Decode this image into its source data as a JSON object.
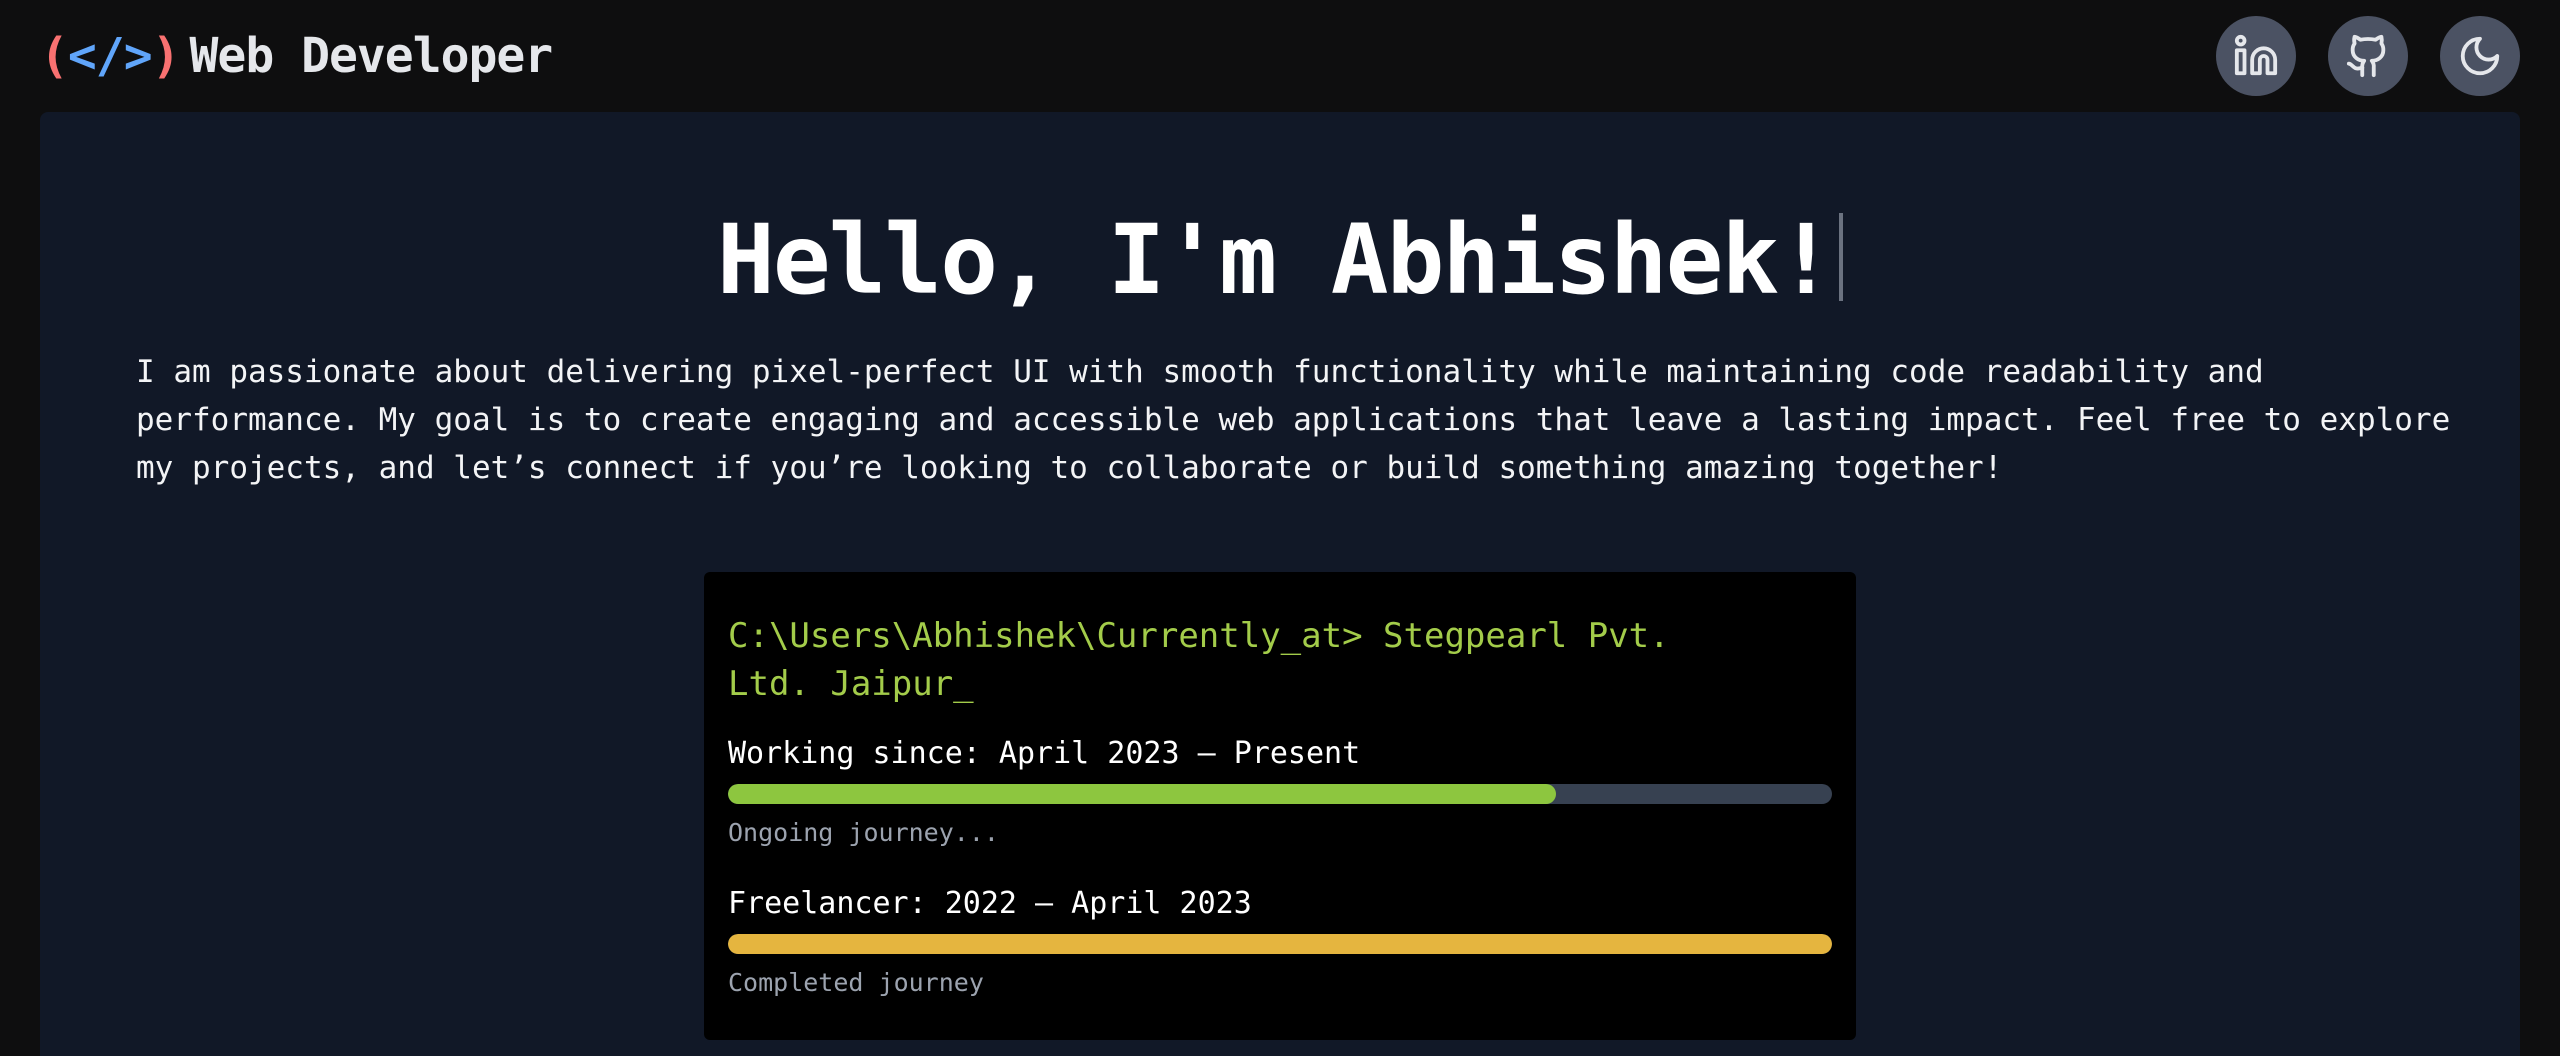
{
  "header": {
    "logo": {
      "open_paren": "(",
      "tag": "</>",
      "close_paren": ")",
      "name": "Web Developer"
    },
    "buttons": [
      {
        "icon": "linkedin-icon"
      },
      {
        "icon": "github-icon"
      },
      {
        "icon": "moon-icon"
      }
    ]
  },
  "hero": {
    "title": "Hello, I'm Abhishek!",
    "intro": "I am passionate about delivering pixel-perfect UI with smooth functionality while maintaining code readability and performance. My goal is to create engaging and accessible web applications that leave a lasting impact. Feel free to explore my projects, and let’s connect if you’re looking to collaborate or build something amazing together!"
  },
  "terminal": {
    "prompt": "C:\\Users\\Abhishek\\Currently_at> Stegpearl Pvt. Ltd. Jaipur_",
    "jobs": [
      {
        "title": "Working since: April 2023 – Present",
        "progress": 0.75,
        "color": "#8dc63f",
        "status": "Ongoing journey..."
      },
      {
        "title": "Freelancer: 2022 – April 2023",
        "progress": 1.0,
        "color": "#e5b53f",
        "status": "Completed journey"
      }
    ]
  },
  "colors": {
    "background": "#0e0e0f",
    "panel": "#111827",
    "accent_red": "#f87171",
    "accent_blue": "#60a5fa",
    "prompt_green": "#a3cc4a"
  }
}
